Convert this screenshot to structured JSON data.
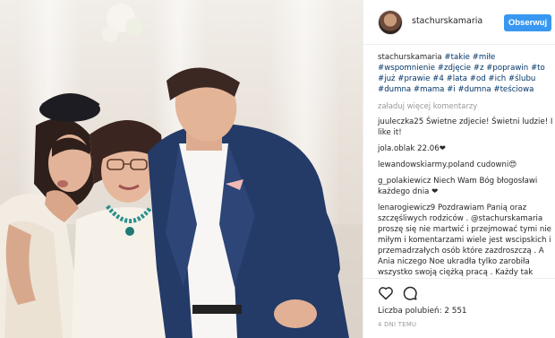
{
  "post": {
    "username": "stachurskamaria",
    "follow_label": "Obserwuj"
  },
  "caption": {
    "user": "stachurskamaria",
    "text": "#takie #miłe #wspomnienie #zdjęcie #z #poprawin #to #już #prawie #4 #lata #od #ich #ślubu #dumna #mama #i #dumna #teściowa"
  },
  "load_more_label": "załaduj więcej komentarzy",
  "comments": [
    {
      "user": "juuleczka25",
      "text": "Świetne zdjecie! Świetni ludzie! I like it!"
    },
    {
      "user": "jola.oblak",
      "text": "22.06❤"
    },
    {
      "user": "lewandowskiarmy.poland",
      "text": "cudowni😍"
    },
    {
      "user": "g_polakiewicz",
      "text": "Niech Wam Bóg błogosławi każdego dnia ❤"
    },
    {
      "user": "lenarogiewicz9",
      "text": "Pozdrawiam Panią oraz szczęśliwych rodziców . @stachurskamaria proszę się nie martwić i przejmować tymi nie miłym i komentarzami wiele jest wscipskich i przemadrzałych osób które zazdroszczą . A Ania niczego Noe ukradła tylko zarobiła wszystko swoją ciężką pracą . Każdy tak gada Ale gdyby się przyłożył"
    }
  ],
  "likes": "Liczba polubień: 2 551",
  "time": "4 DNI TEMU",
  "colors": {
    "accent": "#3897f0",
    "hashtag": "#003569",
    "muted": "#999999"
  }
}
